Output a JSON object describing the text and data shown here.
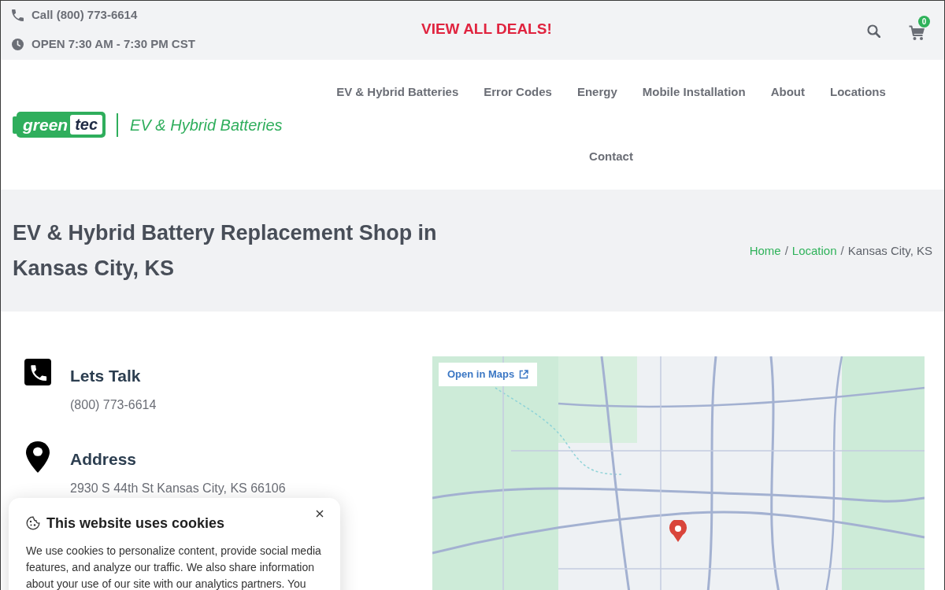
{
  "top_bar": {
    "phone": "Call (800) 773-6614",
    "hours": "OPEN 7:30 AM - 7:30 PM CST",
    "deals_link": "VIEW ALL DEALS!",
    "cart_count": "0"
  },
  "header": {
    "logo": {
      "brand_left": "green",
      "brand_right": "tec",
      "tagline": "EV & Hybrid Batteries"
    },
    "nav": [
      {
        "label": "EV & Hybrid Batteries"
      },
      {
        "label": "Error Codes"
      },
      {
        "label": "Energy"
      },
      {
        "label": "Mobile Installation"
      },
      {
        "label": "About"
      },
      {
        "label": "Locations"
      },
      {
        "label": "Contact"
      }
    ]
  },
  "page_title": {
    "title": "EV & Hybrid Battery Replacement Shop in Kansas City, KS",
    "breadcrumb": [
      {
        "label": "Home",
        "kind": "link"
      },
      {
        "label": "/",
        "kind": "separator"
      },
      {
        "label": "Location",
        "kind": "link"
      },
      {
        "label": "/",
        "kind": "separator"
      },
      {
        "label": "Kansas City, KS",
        "kind": "current"
      }
    ]
  },
  "contact": [
    {
      "kind": "phone",
      "heading": "Lets Talk",
      "detail": "(800) 773-6614"
    },
    {
      "kind": "address",
      "heading": "Address",
      "detail": "2930 S 44th St Kansas City, KS 66106"
    }
  ],
  "map": {
    "open_button": "Open in Maps"
  },
  "cookie_banner": {
    "title": "This website uses cookies",
    "body": "We use cookies to personalize content, provide social media features, and analyze our traffic. We also share information about your use of our site with our analytics partners. You"
  }
}
